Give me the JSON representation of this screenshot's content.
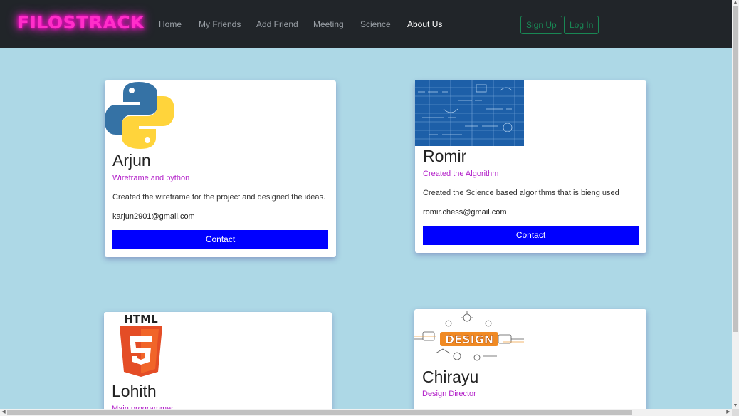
{
  "brand": "FILOSTRACK",
  "nav": {
    "home": "Home",
    "friends": "My Friends",
    "add_friend": "Add Friend",
    "meeting": "Meeting",
    "science": "Science",
    "about": "About Us"
  },
  "auth": {
    "signup": "Sign Up",
    "login": "Log In"
  },
  "colors": {
    "navbar": "#212529",
    "page_bg": "#add8e6",
    "brand_glow": "#ff2ec9",
    "role_text": "#b320c9",
    "contact_button": "#0000ff",
    "auth_outline": "#198754"
  },
  "members": [
    {
      "name": "Arjun",
      "role": "Wireframe and python",
      "description": "Created the wireframe for the project and designed the ideas.",
      "email": "karjun2901@gmail.com",
      "contact_label": "Contact",
      "image": "python-logo-icon"
    },
    {
      "name": "Romir",
      "role": "Created the Algorithm",
      "description": "Created the Science based algorithms that is bieng used",
      "email": "romir.chess@gmail.com",
      "contact_label": "Contact",
      "image": "blueprint-math-image"
    },
    {
      "name": "Lohith",
      "role": "Main programmer",
      "image": "html5-logo-icon",
      "image_text": "HTML"
    },
    {
      "name": "Chirayu",
      "role": "Design Director",
      "image": "design-illustration-image",
      "image_text": "DESIGN"
    }
  ]
}
